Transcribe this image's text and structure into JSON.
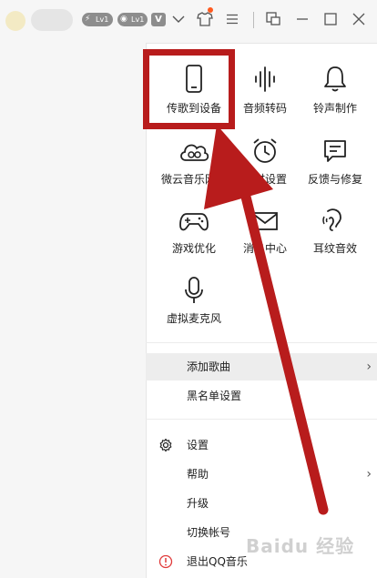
{
  "titlebar": {
    "badges": [
      "Lv1",
      "Lv1"
    ],
    "icons": [
      "bolt-badge-icon",
      "disc-badge-icon",
      "vip-icon",
      "chevron-down-icon",
      "tshirt-icon",
      "menu-icon",
      "mini-mode-icon",
      "minimize-icon",
      "maximize-icon",
      "close-icon"
    ]
  },
  "tools": [
    {
      "label": "传歌到设备",
      "icon": "phone-icon"
    },
    {
      "label": "音频转码",
      "icon": "waveform-icon"
    },
    {
      "label": "铃声制作",
      "icon": "bell-icon"
    },
    {
      "label": "微云音乐网盘",
      "icon": "cloud-icon"
    },
    {
      "label": "定时设置",
      "icon": "alarm-clock-icon"
    },
    {
      "label": "反馈与修复",
      "icon": "feedback-icon"
    },
    {
      "label": "游戏优化",
      "icon": "gamepad-icon"
    },
    {
      "label": "消息中心",
      "icon": "mail-icon"
    },
    {
      "label": "耳纹音效",
      "icon": "ear-icon"
    },
    {
      "label": "虚拟麦克风",
      "icon": "microphone-icon"
    }
  ],
  "menu": {
    "add_song": "添加歌曲",
    "blacklist": "黑名单设置",
    "settings": "设置",
    "help": "帮助",
    "upgrade": "升级",
    "switch_account": "切换帐号",
    "quit": "退出QQ音乐"
  },
  "watermark": "Baidu 经验",
  "colors": {
    "highlight_red": "#b81c1c",
    "quit_icon": "#e03a3a"
  }
}
